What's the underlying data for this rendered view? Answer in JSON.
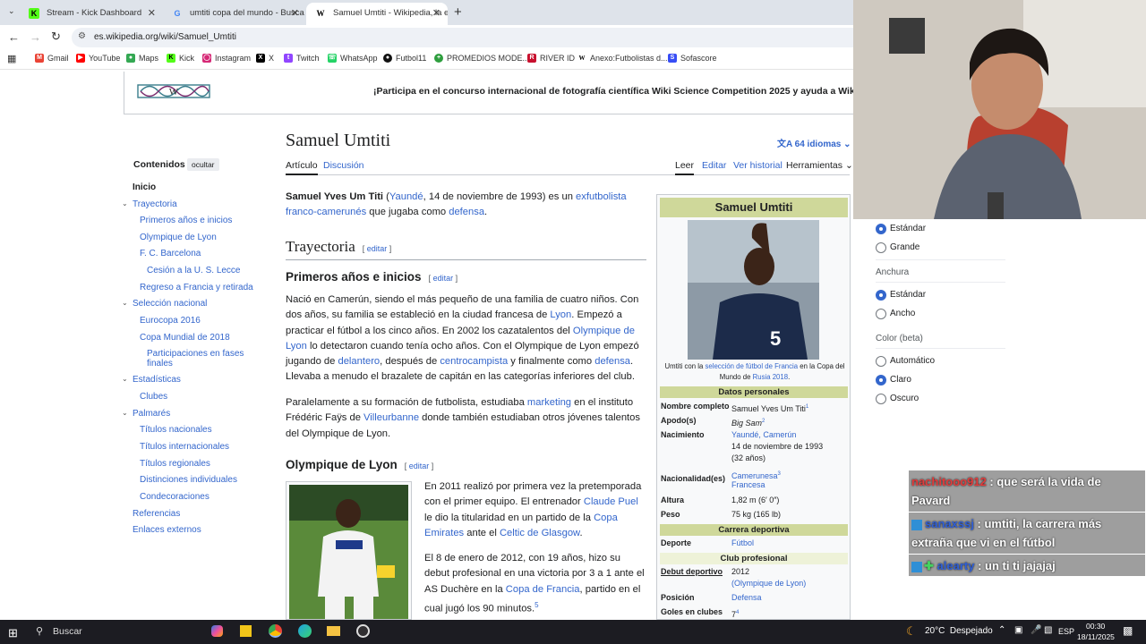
{
  "browser": {
    "tabs": [
      {
        "title": "Stream - Kick Dashboard",
        "icon": "K"
      },
      {
        "title": "umtiti copa del mundo - Busca",
        "icon": "G"
      },
      {
        "title": "Samuel Umtiti - Wikipedia, la e",
        "icon": "W"
      }
    ],
    "url": "es.wikipedia.org/wiki/Samuel_Umtiti",
    "bookmarks": [
      "Gmail",
      "YouTube",
      "Maps",
      "Kick",
      "Instagram",
      "X",
      "Twitch",
      "WhatsApp",
      "Futbol11",
      "PROMEDIOS MODE...",
      "RIVER ID",
      "Anexo:Futbolistas d...",
      "Sofascore"
    ]
  },
  "banner": {
    "text": "¡Participa en el concurso internacional de fotografía científica Wiki Science Competition 2025 y ayuda a Wikipe"
  },
  "article": {
    "title": "Samuel Umtiti",
    "languages": "64 idiomas",
    "tabs": {
      "article": "Artículo",
      "discussion": "Discusión",
      "read": "Leer",
      "edit": "Editar",
      "history": "Ver historial",
      "tools": "Herramientas"
    },
    "edit_label": "editar",
    "intro": {
      "bold": "Samuel Yves Um Titi",
      "paren_open": " (",
      "link1": "Yaundé",
      "mid1": ", 14 de noviembre de 1993) es un ",
      "link2": "exfutbolista franco-camerunés",
      "mid2": " que jugaba como ",
      "link3": "defensa",
      "end": "."
    },
    "h_trayectoria": "Trayectoria",
    "h_primeros": "Primeros años e inicios",
    "p1": {
      "a": "Nació en Camerún, siendo el más pequeño de una familia de cuatro niños. Con dos años, su familia se estableció en la ciudad francesa de ",
      "l1": "Lyon",
      "b": ". Empezó a practicar el fútbol a los cinco años. En 2002 los cazatalentos del ",
      "l2": "Olympique de Lyon",
      "c": " lo detectaron cuando tenía ocho años. Con el Olympique de Lyon empezó jugando de ",
      "l3": "delantero",
      "d": ", después de ",
      "l4": "centrocampista",
      "e": " y finalmente como ",
      "l5": "defensa",
      "f": ". Llevaba a menudo el brazalete de capitán en las categorías inferiores del club."
    },
    "p2": {
      "a": "Paralelamente a su formación de futbolista, estudiaba ",
      "l1": "marketing",
      "b": " en el instituto Frédéric Faÿs de ",
      "l2": "Villeurbanne",
      "c": " donde también estudiaban otros jóvenes talentos del Olympique de Lyon."
    },
    "h_olympique": "Olympique de Lyon",
    "p3": {
      "a": "En 2011 realizó por primera vez la pretemporada con el primer equipo. El entrenador ",
      "l1": "Claude Puel",
      "b": " le dio la titularidad en un partido de la ",
      "l2": "Copa Emirates",
      "c": " ante el ",
      "l3": "Celtic de Glasgow",
      "d": "."
    },
    "p4": {
      "a": "El 8 de enero de 2012, con 19 años, hizo su debut profesional en una victoria por 3 a 1 ante el AS Duchère en la ",
      "l1": "Copa de Francia",
      "b": ", partido en el cual jugó los 90 minutos.",
      "sup": "5"
    }
  },
  "toc": {
    "title": "Contenidos",
    "hide": "ocultar",
    "items": [
      "Inicio",
      "Trayectoria",
      "Primeros años e inicios",
      "Olympique de Lyon",
      "F. C. Barcelona",
      "Cesión a la U. S. Lecce",
      "Regreso a Francia y retirada",
      "Selección nacional",
      "Eurocopa 2016",
      "Copa Mundial de 2018",
      "Participaciones en fases finales",
      "Estadísticas",
      "Clubes",
      "Palmarés",
      "Títulos nacionales",
      "Títulos internacionales",
      "Títulos regionales",
      "Distinciones individuales",
      "Condecoraciones",
      "Referencias",
      "Enlaces externos"
    ]
  },
  "infobox": {
    "title": "Samuel Umtiti",
    "caption_a": "Umtiti con la ",
    "caption_l1": "selección de fútbol de Francia",
    "caption_b": " en la Copa del Mundo de ",
    "caption_l2": "Rusia 2018",
    "caption_c": ".",
    "personal": "Datos personales",
    "rows1": [
      {
        "k": "Nombre completo",
        "v": "Samuel Yves Um Titi",
        "sup": "1"
      },
      {
        "k": "Apodo(s)",
        "v": "Big Sam",
        "sup": "2"
      },
      {
        "k": "Nacimiento",
        "v": "Yaundé, Camerún",
        "v2": "14 de noviembre de 1993",
        "v3": "(32 años)"
      },
      {
        "k": "Nacionalidad(es)",
        "v": "Camerunesa",
        "sup": "3",
        "v2": "Francesa"
      },
      {
        "k": "Altura",
        "v": "1,82 m (6′ 0″)"
      },
      {
        "k": "Peso",
        "v": "75 kg (165 lb)"
      }
    ],
    "career": "Carrera deportiva",
    "sport_k": "Deporte",
    "sport_v": "Fútbol",
    "club_band": "Club profesional",
    "debut_k": "Debut deportivo",
    "debut_v": "2012",
    "debut_v2": "(Olympique de Lyon)",
    "pos_k": "Posición",
    "pos_v": "Defensa",
    "goals_k": "Goles en clubes",
    "goals_v": "7",
    "goals_sup": "4"
  },
  "prefs": {
    "size_std": "Estándar",
    "size_large": "Grande",
    "width_title": "Anchura",
    "width_std": "Estándar",
    "width_wide": "Ancho",
    "color_title": "Color (beta)",
    "color_auto": "Automático",
    "color_light": "Claro",
    "color_dark": "Oscuro"
  },
  "chat": [
    {
      "user": "nachitooo912",
      "msg": " : que será la vida de Pavard",
      "color": "#e23b3b"
    },
    {
      "user": "sanaxssj",
      "msg": " : umtiti, la carrera más extraña que vi en el fútbol",
      "color": "#2f5fd6"
    },
    {
      "user": "alearty",
      "msg": " : un ti ti jajajaj",
      "color": "#2f5fd6"
    }
  ],
  "taskbar": {
    "search": "Buscar",
    "weather": "20°C  Despejado",
    "lang": "ESP",
    "time": "00:30",
    "date": "18/11/2025"
  }
}
